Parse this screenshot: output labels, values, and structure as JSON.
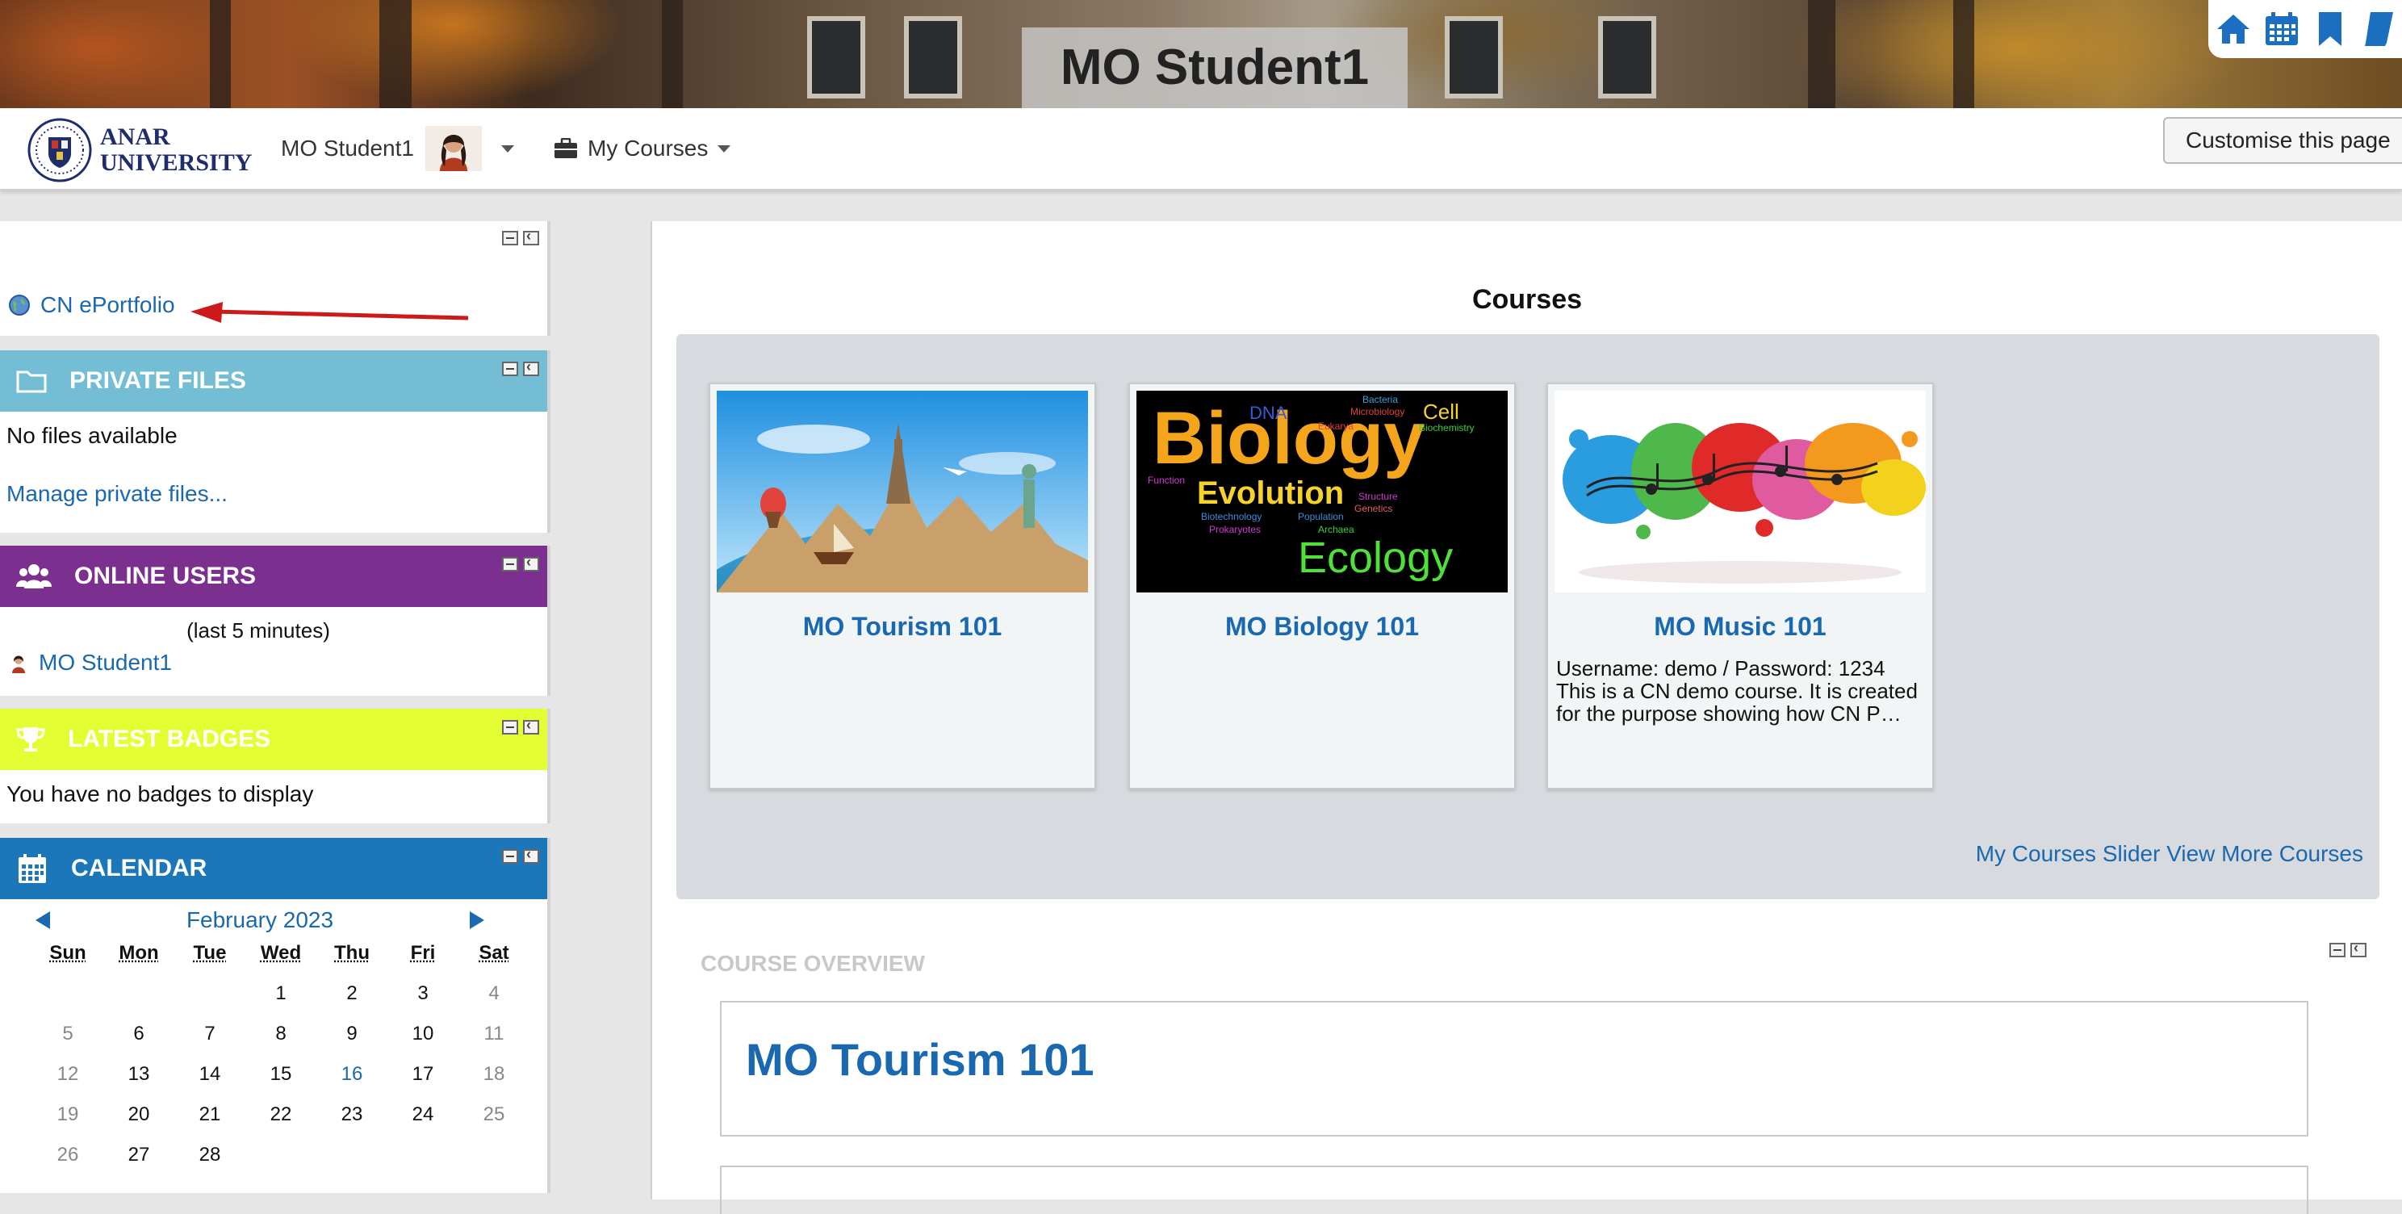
{
  "banner": {
    "title": "MO Student1"
  },
  "top_icons": [
    "home-icon",
    "calendar-icon",
    "bookmark-icon",
    "book-icon"
  ],
  "brand": {
    "line1": "ANAR",
    "line2": "UNIVERSITY"
  },
  "nav": {
    "user_name": "MO Student1",
    "my_courses": "My Courses",
    "customise": "Customise this page"
  },
  "eportfolio": {
    "link": "CN ePortfolio"
  },
  "private_files": {
    "title": "PRIVATE FILES",
    "empty": "No files available",
    "manage": "Manage private files..."
  },
  "online_users": {
    "title": "ONLINE USERS",
    "window": "(last 5 minutes)",
    "users": [
      "MO Student1"
    ]
  },
  "badges": {
    "title": "LATEST BADGES",
    "empty": "You have no badges to display"
  },
  "calendar": {
    "title": "CALENDAR",
    "month": "February 2023",
    "days": [
      "Sun",
      "Mon",
      "Tue",
      "Wed",
      "Thu",
      "Fri",
      "Sat"
    ],
    "weeks": [
      [
        "",
        "",
        "",
        "1",
        "2",
        "3",
        "4"
      ],
      [
        "5",
        "6",
        "7",
        "8",
        "9",
        "10",
        "11"
      ],
      [
        "12",
        "13",
        "14",
        "15",
        "16",
        "17",
        "18"
      ],
      [
        "19",
        "20",
        "21",
        "22",
        "23",
        "24",
        "25"
      ],
      [
        "26",
        "27",
        "28",
        "",
        "",
        "",
        ""
      ]
    ],
    "today": "16"
  },
  "courses": {
    "title": "Courses",
    "items": [
      {
        "name": "MO Tourism 101",
        "summary": ""
      },
      {
        "name": "MO Biology 101",
        "summary": ""
      },
      {
        "name": "MO Music 101",
        "summary": "Username: demo / Password: 1234 This is a CN demo course. It is created for the purpose showing how CN P…"
      }
    ],
    "biology_image_words": [
      "Biology",
      "Evolution",
      "Ecology",
      "Cell",
      "DNA",
      "Bacteria",
      "Microbiology",
      "Biochemistry",
      "Eukarya",
      "Function",
      "Biotechnology",
      "Population",
      "Genetics",
      "Structure",
      "Prokaryotes",
      "Archaea"
    ],
    "more": "My Courses Slider View More Courses"
  },
  "overview": {
    "label": "COURSE OVERVIEW",
    "first_course": "MO Tourism 101"
  },
  "colors": {
    "private_files": "#74bed5",
    "online_users": "#7b2f8f",
    "badges": "#e3ff33",
    "calendar": "#1b76ba",
    "link": "#1a68b0"
  }
}
